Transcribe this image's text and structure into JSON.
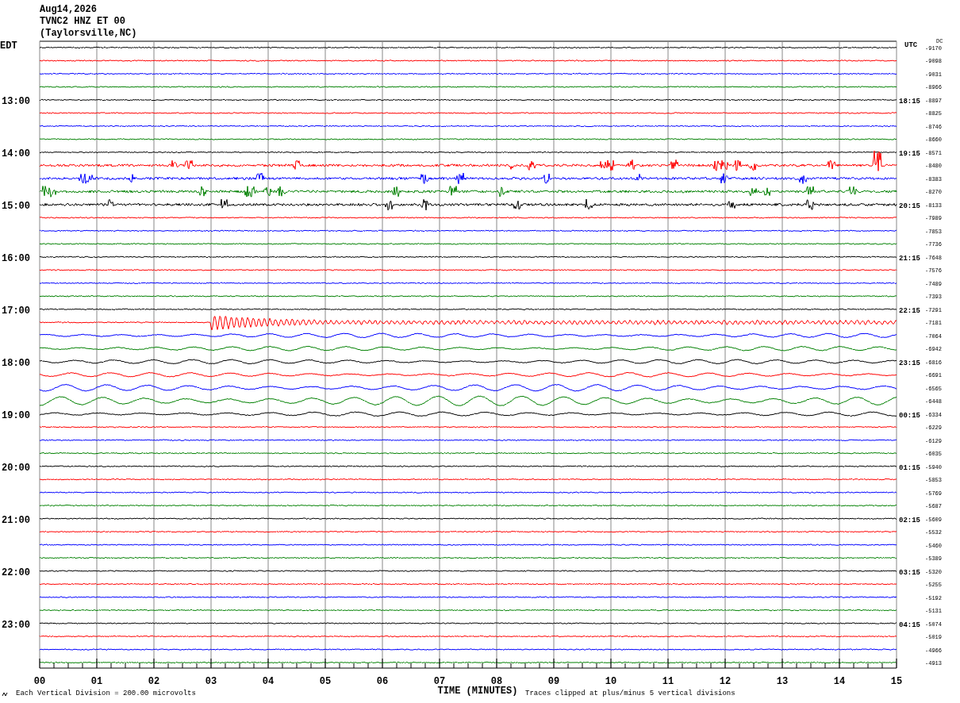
{
  "header": {
    "date": "Aug14,2026",
    "station": "TVNC2 HNZ ET 00",
    "location": "(Taylorsville,NC)"
  },
  "left_zone": "EDT",
  "right_zone": "UTC",
  "dc_header": "DC",
  "traces": [
    {
      "color": "#000000",
      "kind": "quiet",
      "dc": "-9170"
    },
    {
      "color": "#ff0000",
      "kind": "quiet",
      "dc": "-9098"
    },
    {
      "color": "#0000ff",
      "kind": "quiet",
      "dc": "-9031"
    },
    {
      "color": "#008000",
      "kind": "quiet",
      "dc": "-8966"
    },
    {
      "color": "#000000",
      "kind": "quiet",
      "dc": "-8897",
      "edt": "13:00",
      "utc": "18:15"
    },
    {
      "color": "#ff0000",
      "kind": "quiet",
      "dc": "-8825"
    },
    {
      "color": "#0000ff",
      "kind": "quiet",
      "dc": "-8746"
    },
    {
      "color": "#008000",
      "kind": "quiet",
      "dc": "-8660"
    },
    {
      "color": "#000000",
      "kind": "quiet",
      "dc": "-8571",
      "edt": "14:00",
      "utc": "19:15"
    },
    {
      "color": "#ff0000",
      "kind": "noisy",
      "dc": "-8480"
    },
    {
      "color": "#0000ff",
      "kind": "noisy",
      "dc": "-8383"
    },
    {
      "color": "#008000",
      "kind": "noisy",
      "dc": "-8270"
    },
    {
      "color": "#000000",
      "kind": "noisy",
      "dc": "-8133",
      "edt": "15:00",
      "utc": "20:15"
    },
    {
      "color": "#ff0000",
      "kind": "quiet",
      "dc": "-7989"
    },
    {
      "color": "#0000ff",
      "kind": "quiet",
      "dc": "-7853"
    },
    {
      "color": "#008000",
      "kind": "quiet",
      "dc": "-7736"
    },
    {
      "color": "#000000",
      "kind": "quiet",
      "dc": "-7648",
      "edt": "16:00",
      "utc": "21:15"
    },
    {
      "color": "#ff0000",
      "kind": "quiet",
      "dc": "-7576"
    },
    {
      "color": "#0000ff",
      "kind": "quiet",
      "dc": "-7489"
    },
    {
      "color": "#008000",
      "kind": "quiet",
      "dc": "-7393"
    },
    {
      "color": "#000000",
      "kind": "quiet",
      "dc": "-7291",
      "edt": "17:00",
      "utc": "22:15"
    },
    {
      "color": "#ff0000",
      "kind": "body-wave",
      "dc": "-7181"
    },
    {
      "color": "#0000ff",
      "kind": "surface-wave",
      "dc": "-7064"
    },
    {
      "color": "#008000",
      "kind": "surface-wave",
      "dc": "-6942"
    },
    {
      "color": "#000000",
      "kind": "surface-wave",
      "dc": "-6816",
      "edt": "18:00",
      "utc": "23:15"
    },
    {
      "color": "#ff0000",
      "kind": "surface-wave",
      "dc": "-6691"
    },
    {
      "color": "#0000ff",
      "kind": "surface-wave",
      "dc": "-6565"
    },
    {
      "color": "#008000",
      "kind": "surface-wave",
      "dc": "-6448"
    },
    {
      "color": "#000000",
      "kind": "surface-wave",
      "dc": "-6334",
      "edt": "19:00",
      "utc": "00:15"
    },
    {
      "color": "#ff0000",
      "kind": "quiet",
      "dc": "-6229"
    },
    {
      "color": "#0000ff",
      "kind": "quiet",
      "dc": "-6129"
    },
    {
      "color": "#008000",
      "kind": "quiet",
      "dc": "-6035"
    },
    {
      "color": "#000000",
      "kind": "quiet",
      "dc": "-5940",
      "edt": "20:00",
      "utc": "01:15"
    },
    {
      "color": "#ff0000",
      "kind": "quiet",
      "dc": "-5853"
    },
    {
      "color": "#0000ff",
      "kind": "quiet",
      "dc": "-5769"
    },
    {
      "color": "#008000",
      "kind": "quiet",
      "dc": "-5687"
    },
    {
      "color": "#000000",
      "kind": "quiet",
      "dc": "-5609",
      "edt": "21:00",
      "utc": "02:15"
    },
    {
      "color": "#ff0000",
      "kind": "quiet",
      "dc": "-5532"
    },
    {
      "color": "#0000ff",
      "kind": "quiet",
      "dc": "-5460"
    },
    {
      "color": "#008000",
      "kind": "quiet",
      "dc": "-5389"
    },
    {
      "color": "#000000",
      "kind": "quiet",
      "dc": "-5320",
      "edt": "22:00",
      "utc": "03:15"
    },
    {
      "color": "#ff0000",
      "kind": "quiet",
      "dc": "-5255"
    },
    {
      "color": "#0000ff",
      "kind": "quiet",
      "dc": "-5192"
    },
    {
      "color": "#008000",
      "kind": "quiet",
      "dc": "-5131"
    },
    {
      "color": "#000000",
      "kind": "quiet",
      "dc": "-5074",
      "edt": "23:00",
      "utc": "04:15"
    },
    {
      "color": "#ff0000",
      "kind": "quiet",
      "dc": "-5019"
    },
    {
      "color": "#0000ff",
      "kind": "quiet",
      "dc": "-4966"
    },
    {
      "color": "#008000",
      "kind": "quiet",
      "dc": "-4913"
    }
  ],
  "x_axis": {
    "labels": [
      "00",
      "01",
      "02",
      "03",
      "04",
      "05",
      "06",
      "07",
      "08",
      "09",
      "10",
      "11",
      "12",
      "13",
      "14",
      "15"
    ],
    "title": "TIME (MINUTES)"
  },
  "scale_note": "Each Vertical Division =  200.00 microvolts",
  "clip_note": "Traces clipped at plus/minus 5 vertical divisions"
}
